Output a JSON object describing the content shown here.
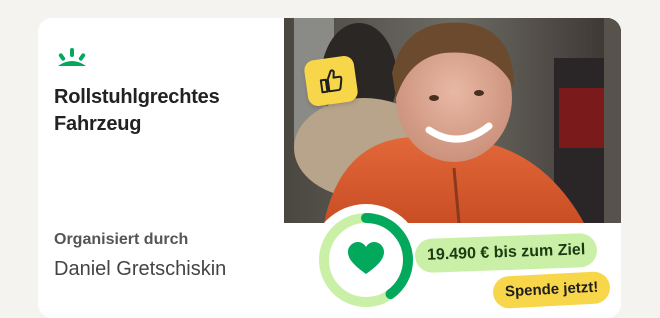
{
  "card": {
    "title_line1": "Rollstuhlgrechtes",
    "title_line2": "Fahrzeug",
    "organized_label": "Organisiert durch",
    "organizer": "Daniel Gretschiskin",
    "goal_text": "19.490 € bis zum Ziel",
    "donate_label": "Spende jetzt!"
  },
  "icons": {
    "logo": "brand-sprout-icon",
    "thumb": "thumbs-up-icon",
    "heart": "heart-icon"
  },
  "progress": {
    "fraction": 0.4
  },
  "colors": {
    "brand_green": "#02a95c",
    "ring_light": "#c9f0a6",
    "goal_pill": "#c9f0a6",
    "donate_pill": "#f7d64a",
    "thumb_badge": "#f7d64a"
  }
}
